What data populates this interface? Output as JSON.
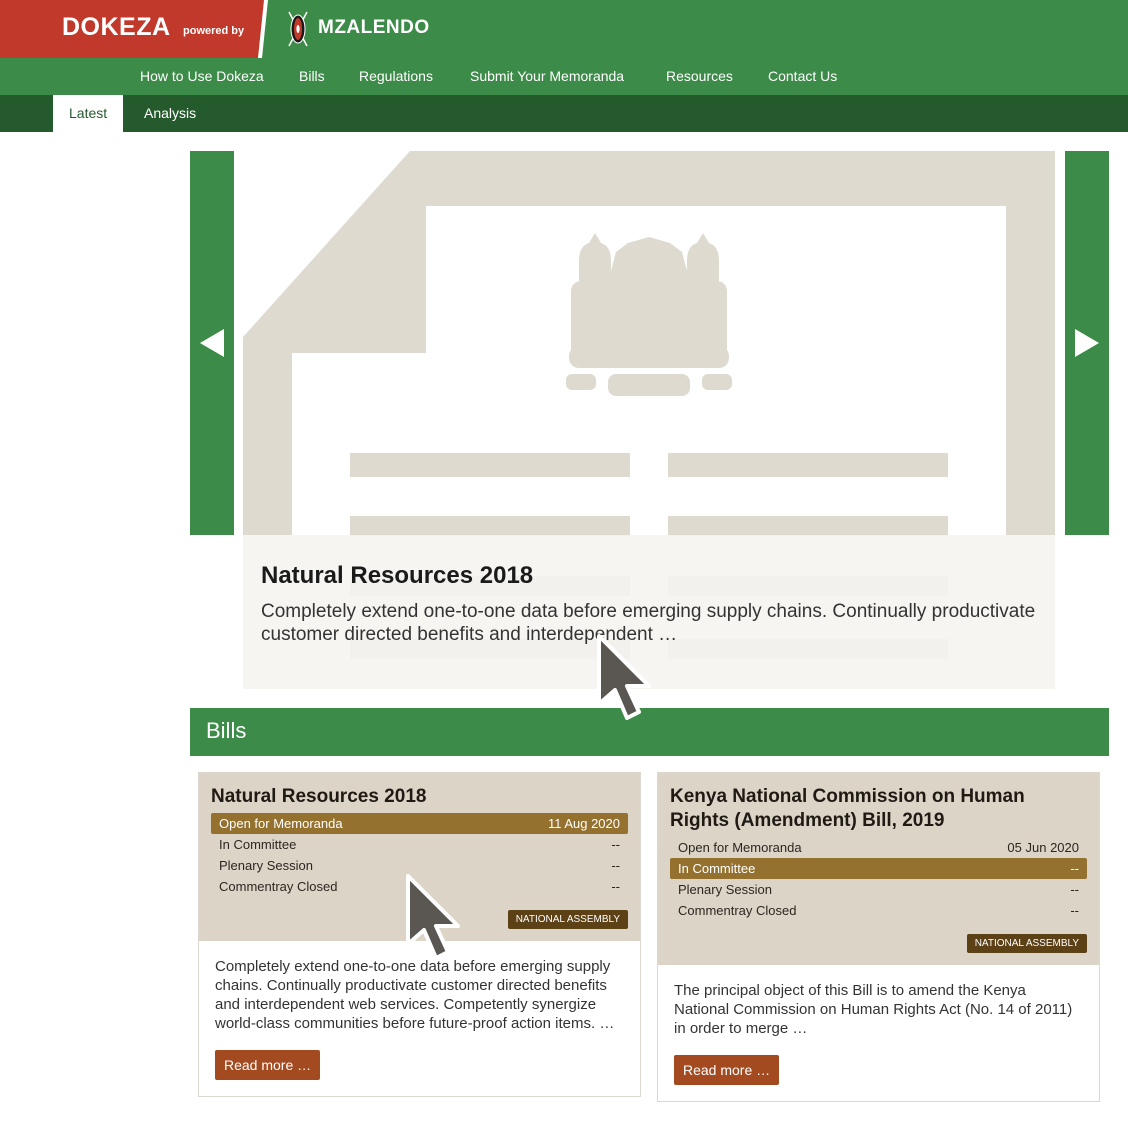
{
  "brand": {
    "name": "DOKEZA",
    "powered_by": "powered by",
    "partner": "MZALENDO"
  },
  "nav": {
    "items": [
      {
        "label": "How to Use Dokeza"
      },
      {
        "label": "Bills"
      },
      {
        "label": "Regulations"
      },
      {
        "label": "Submit Your Memoranda"
      },
      {
        "label": "Resources"
      },
      {
        "label": "Contact Us"
      }
    ]
  },
  "subnav": {
    "tabs": [
      {
        "label": "Latest",
        "active": true
      },
      {
        "label": "Analysis",
        "active": false
      }
    ]
  },
  "carousel": {
    "title": "Natural Resources 2018",
    "description": "Completely extend one-to-one data before emerging supply chains. Continually productivate customer directed benefits and interdependent …",
    "prev_icon": "triangle-left-icon",
    "next_icon": "triangle-right-icon"
  },
  "bills_section": {
    "heading": "Bills"
  },
  "cards": [
    {
      "title": "Natural Resources 2018",
      "stages": [
        {
          "label": "Open for Memoranda",
          "date": "11 Aug 2020",
          "active": true
        },
        {
          "label": "In Committee",
          "date": "--",
          "active": false
        },
        {
          "label": "Plenary Session",
          "date": "--",
          "active": false
        },
        {
          "label": "Commentray Closed",
          "date": "--",
          "active": false
        }
      ],
      "badge": "NATIONAL ASSEMBLY",
      "description": "Completely extend one-to-one data before emerging supply chains. Continually productivate customer directed benefits and interdependent web services. Competently synergize world-class communities before future-proof action items. …",
      "read_more": "Read more …"
    },
    {
      "title": "Kenya National Commission on Human Rights (Amendment) Bill, 2019",
      "stages": [
        {
          "label": "Open for Memoranda",
          "date": "05 Jun 2020",
          "active": false
        },
        {
          "label": "In Committee",
          "date": "--",
          "active": true
        },
        {
          "label": "Plenary Session",
          "date": "--",
          "active": false
        },
        {
          "label": "Commentray Closed",
          "date": "--",
          "active": false
        }
      ],
      "badge": "NATIONAL ASSEMBLY",
      "description": "The principal object of this Bill is to amend the Kenya National Commission on Human Rights Act (No. 14 of 2011) in order to merge …",
      "read_more": "Read more …"
    }
  ],
  "colors": {
    "brand_green": "#3d8b48",
    "brand_red": "#c0392b",
    "dark_green": "#255a2d",
    "card_beige": "#dcd4c7",
    "stage_active": "#94712f",
    "badge_brown": "#5c4116",
    "button_rust": "#a34a21"
  }
}
